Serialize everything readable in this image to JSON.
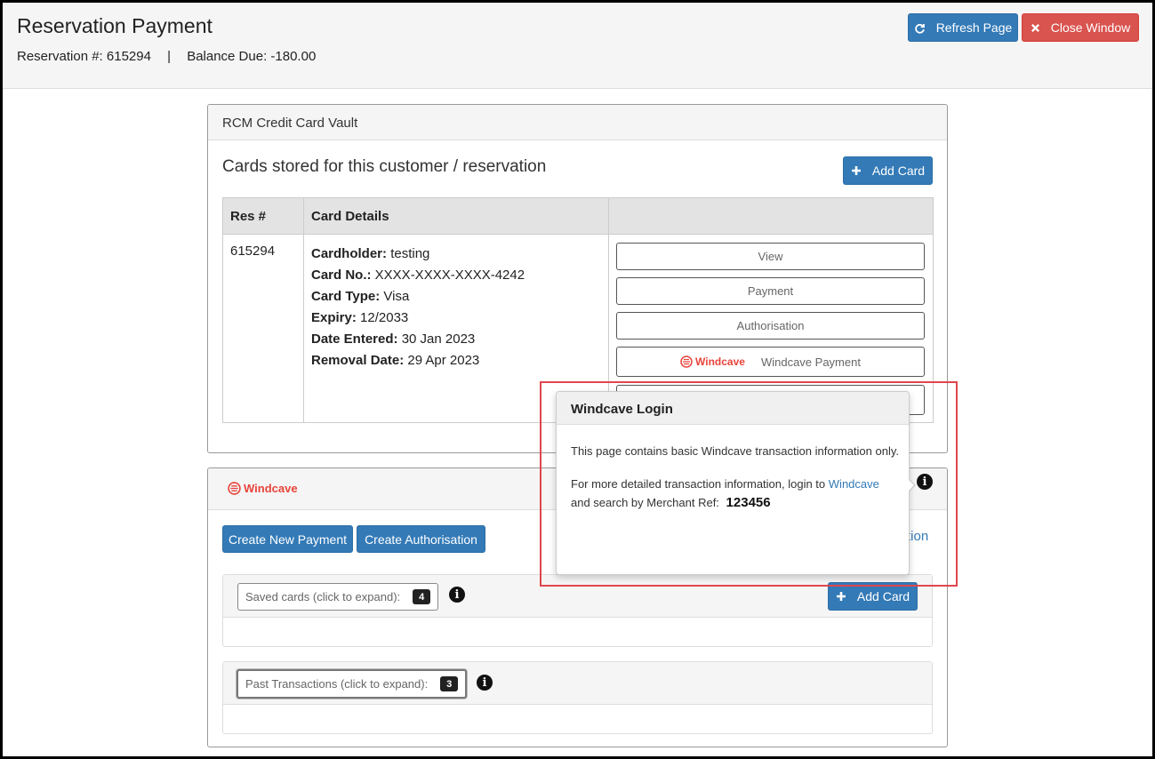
{
  "header": {
    "title": "Reservation Payment",
    "reservation_label": "Reservation #: 615294",
    "separator": "|",
    "balance_label": "Balance Due: -180.00",
    "refresh_label": "Refresh Page",
    "close_label": "Close Window"
  },
  "vault": {
    "title": "RCM Credit Card Vault",
    "heading": "Cards stored for this customer / reservation",
    "add_card_label": "Add Card",
    "columns": [
      "Res #",
      "Card Details",
      ""
    ],
    "row": {
      "res_no": "615294",
      "details": [
        {
          "label": "Cardholder:",
          "value": "testing"
        },
        {
          "label": "Card No.:",
          "value": "XXXX-XXXX-XXXX-4242"
        },
        {
          "label": "Card Type:",
          "value": "Visa"
        },
        {
          "label": "Expiry:",
          "value": "12/2033"
        },
        {
          "label": "Date Entered:",
          "value": "30 Jan 2023"
        },
        {
          "label": "Removal Date:",
          "value": "29 Apr 2023"
        }
      ],
      "actions": {
        "view": "View",
        "payment": "Payment",
        "authorisation": "Authorisation",
        "windcave_payment": "Windcave Payment"
      }
    }
  },
  "windcave": {
    "logo_text": "Windcave",
    "create_payment_label": "Create New Payment",
    "create_auth_label": "Create Authorisation",
    "partial_link_text": "tion",
    "saved_cards_label": "Saved cards (click to expand):",
    "saved_cards_count": "4",
    "add_card_label": "Add Card",
    "past_tx_label": "Past Transactions (click to expand):",
    "past_tx_count": "3"
  },
  "popover": {
    "title": "Windcave Login",
    "para1": "This page contains basic Windcave transaction information only.",
    "para2_prefix": "For more detailed transaction information, login to",
    "link_text": "Windcave",
    "para2_suffix": "and search by Merchant Ref:",
    "merchant_ref": "123456"
  },
  "colors": {
    "primary": "#337ab7",
    "danger": "#d9534f",
    "windcave_red": "#e8443b",
    "highlight": "#e0464e"
  },
  "icons": {
    "refresh": "refresh-icon",
    "close": "close-icon",
    "plus": "plus-icon",
    "info": "info-icon",
    "windcave": "windcave-logo-icon"
  }
}
